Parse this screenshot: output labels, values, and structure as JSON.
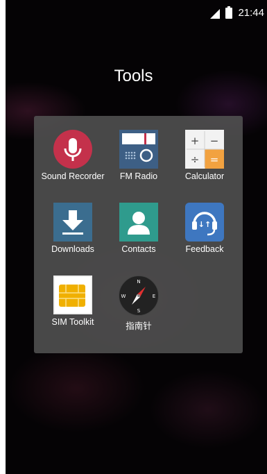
{
  "status_bar": {
    "time": "21:44"
  },
  "folder": {
    "title": "Tools"
  },
  "apps": [
    {
      "label": "Sound Recorder",
      "icon": "microphone-icon",
      "color": "#c4314b"
    },
    {
      "label": "FM Radio",
      "icon": "radio-icon",
      "color": "#3d5f85"
    },
    {
      "label": "Calculator",
      "icon": "calculator-icon",
      "color": "#f2f2f2"
    },
    {
      "label": "Downloads",
      "icon": "download-arrow-icon",
      "color": "#3b6d8f"
    },
    {
      "label": "Contacts",
      "icon": "person-icon",
      "color": "#2f9b8d"
    },
    {
      "label": "Feedback",
      "icon": "headset-icon",
      "color": "#3e77c0"
    },
    {
      "label": "SIM Toolkit",
      "icon": "sim-card-icon",
      "color": "#f0b000"
    },
    {
      "label": "指南针",
      "icon": "compass-icon",
      "color": "#222222"
    }
  ],
  "calculator_keys": [
    "+",
    "−",
    "÷",
    "="
  ],
  "compass_letters": [
    "N",
    "E",
    "S",
    "W"
  ]
}
